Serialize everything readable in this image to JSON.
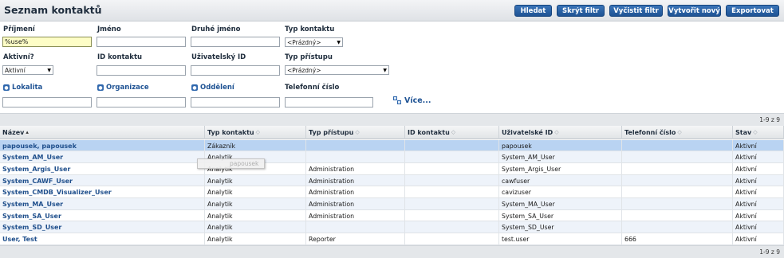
{
  "header": {
    "title": "Seznam kontaktů",
    "buttons": {
      "search": "Hledat",
      "hide_filter": "Skrýt filtr",
      "clear_filter": "Vyčistit filtr",
      "create_new": "Vytvořit nový",
      "export": "Exportovat"
    }
  },
  "filters": {
    "surname": {
      "label": "Příjmení",
      "value": "%use%"
    },
    "first_name": {
      "label": "Jméno",
      "value": ""
    },
    "middle_name": {
      "label": "Druhé jméno",
      "value": ""
    },
    "contact_type": {
      "label": "Typ kontaktu",
      "value": "<Prázdný>"
    },
    "active": {
      "label": "Aktivní?",
      "value": "Aktivní"
    },
    "contact_id": {
      "label": "ID kontaktu",
      "value": ""
    },
    "user_id": {
      "label": "Uživatelský ID",
      "value": ""
    },
    "access_type": {
      "label": "Typ přístupu",
      "value": "<Prázdný>"
    },
    "location": {
      "label": "Lokalita",
      "value": ""
    },
    "organization": {
      "label": "Organizace",
      "value": ""
    },
    "department": {
      "label": "Oddělení",
      "value": ""
    },
    "phone": {
      "label": "Telefonní číslo",
      "value": ""
    },
    "more": "Více..."
  },
  "pagination": {
    "count": "1-9 z 9"
  },
  "table": {
    "columns": [
      "Název",
      "Typ kontaktu",
      "Typ přístupu",
      "ID kontaktu",
      "Uživatelské ID",
      "Telefonní číslo",
      "Stav"
    ],
    "rows": [
      [
        "papousek, papousek",
        "Zákazník",
        "",
        "",
        "papousek",
        "",
        "Aktivní"
      ],
      [
        "System_AM_User",
        "Analytik",
        "",
        "",
        "System_AM_User",
        "",
        "Aktivní"
      ],
      [
        "System_Argis_User",
        "Analytik",
        "Administration",
        "",
        "System_Argis_User",
        "",
        "Aktivní"
      ],
      [
        "System_CAWF_User",
        "Analytik",
        "Administration",
        "",
        "cawfuser",
        "",
        "Aktivní"
      ],
      [
        "System_CMDB_Visualizer_User",
        "Analytik",
        "Administration",
        "",
        "cavizuser",
        "",
        "Aktivní"
      ],
      [
        "System_MA_User",
        "Analytik",
        "Administration",
        "",
        "System_MA_User",
        "",
        "Aktivní"
      ],
      [
        "System_SA_User",
        "Analytik",
        "Administration",
        "",
        "System_SA_User",
        "",
        "Aktivní"
      ],
      [
        "System_SD_User",
        "Analytik",
        "",
        "",
        "System_SD_User",
        "",
        "Aktivní"
      ],
      [
        "User, Test",
        "Analytik",
        "Reporter",
        "",
        "test.user",
        "666",
        "Aktivní"
      ]
    ],
    "drag_ghost": "papousek"
  }
}
